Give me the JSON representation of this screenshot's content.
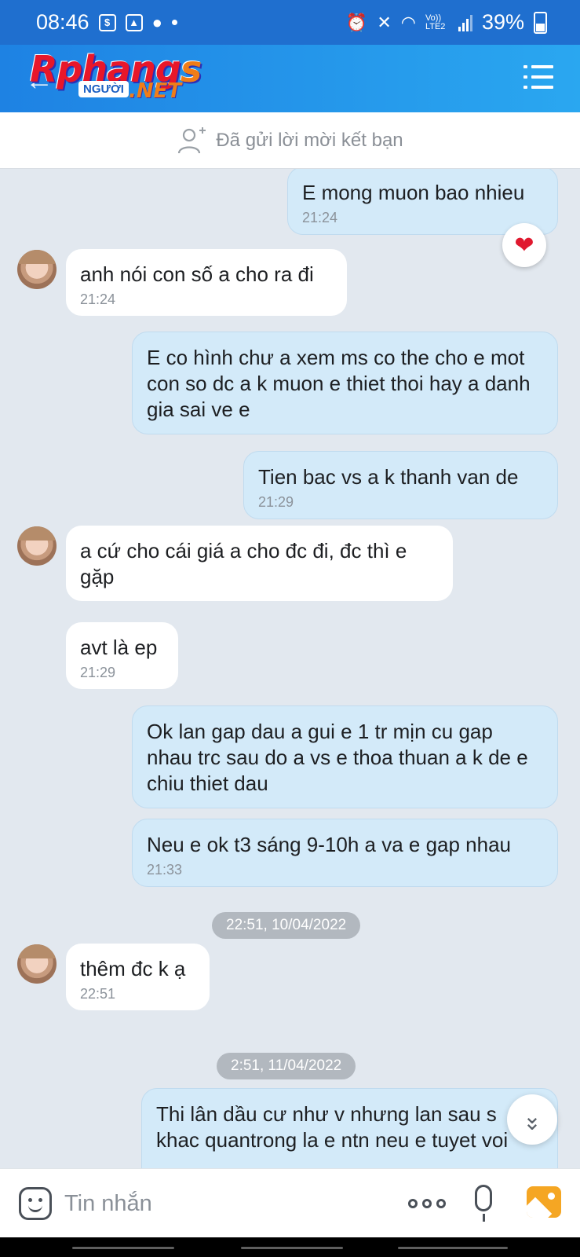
{
  "status_bar": {
    "time": "08:46",
    "network": "Vo)) LTE2",
    "battery": "39%"
  },
  "header": {
    "logo_main": "Rphang",
    "logo_s": "s",
    "logo_sub": "NGƯỜI",
    "logo_net": ".NET"
  },
  "friend_bar": {
    "text": "Đã gửi lời mời kết bạn"
  },
  "messages": [
    {
      "side": "out",
      "text": "E mong muon bao nhieu",
      "time": "21:24"
    },
    {
      "side": "in",
      "text": "anh nói con số a cho ra đi",
      "time": "21:24"
    },
    {
      "side": "out",
      "text": "E co hình chư a xem ms co the cho e mot con so dc a k muon e thiet thoi hay a danh gia sai ve e",
      "time": ""
    },
    {
      "side": "out",
      "text": "Tien bac vs a k thanh van de",
      "time": "21:29"
    },
    {
      "side": "in",
      "text": "a cứ cho cái giá a cho đc đi, đc thì e gặp",
      "time": ""
    },
    {
      "side": "in",
      "text": "avt là ep",
      "time": "21:29"
    },
    {
      "side": "out",
      "text": "Ok lan gap dau a gui e 1 tr  mịn cu gap nhau trc sau do a vs e thoa thuan a k de e chiu thiet dau",
      "time": ""
    },
    {
      "side": "out",
      "text": "Neu e ok t3 sáng 9-10h a va e gap nhau",
      "time": "21:33"
    },
    {
      "side": "in",
      "text": "thêm đc k ạ",
      "time": "22:51"
    },
    {
      "side": "out",
      "text": "Thi lân dầu cư như v nhưng lan sau s khac quantrong la e ntn neu e tuyet voi",
      "time": ""
    }
  ],
  "date_separators": [
    "22:51, 10/04/2022",
    "2:51, 11/04/2022"
  ],
  "input": {
    "placeholder": "Tin nhắn"
  }
}
